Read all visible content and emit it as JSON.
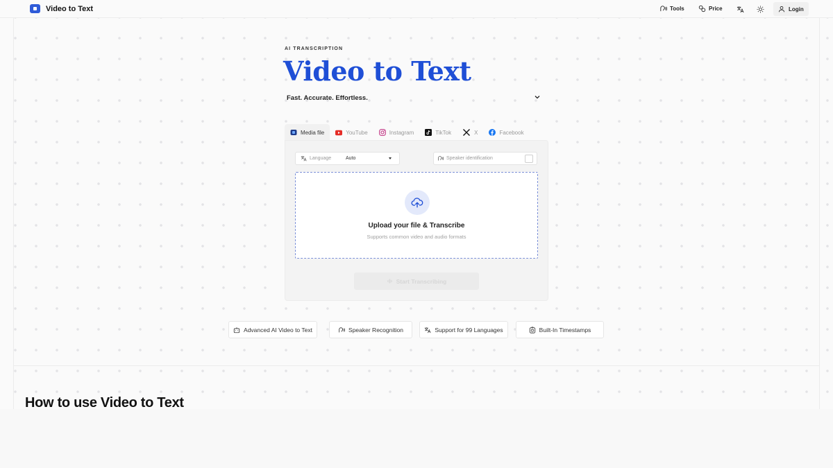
{
  "header": {
    "brand_name": "Video to Text",
    "nav": {
      "tools": "Tools",
      "price": "Price",
      "login": "Login"
    },
    "icons": {
      "translate": "translate-icon",
      "theme": "sun-icon",
      "user": "user-icon"
    }
  },
  "hero": {
    "eyebrow": "AI TRANSCRIPTION",
    "title": "Video to Text",
    "tagline": "Fast. Accurate. Effortless."
  },
  "tabs": [
    {
      "label": "Media file",
      "icon": "media-file-icon"
    },
    {
      "label": "YouTube",
      "icon": "youtube-icon"
    },
    {
      "label": "Instagram",
      "icon": "instagram-icon"
    },
    {
      "label": "TikTok",
      "icon": "tiktok-icon"
    },
    {
      "label": "X",
      "icon": "x-icon"
    },
    {
      "label": "Facebook",
      "icon": "facebook-icon"
    }
  ],
  "options": {
    "language_label": "Language",
    "language_value": "Auto",
    "speaker_label": "Speaker identification"
  },
  "upload": {
    "title": "Upload your file & Transcribe",
    "subtitle": "Supports common video and audio formats"
  },
  "start_button": "Start Transcribing",
  "features": [
    {
      "label": "Advanced AI Video to Text",
      "icon": "bot-icon"
    },
    {
      "label": "Speaker Recognition",
      "icon": "speaker-icon"
    },
    {
      "label": "Support for 99 Languages",
      "icon": "translate-icon"
    },
    {
      "label": "Built-In Timestamps",
      "icon": "timer-icon"
    }
  ],
  "section": {
    "title": "How to use Video to Text"
  },
  "colors": {
    "accent": "#1f4fd6",
    "dropzone_border": "#7a8fd8",
    "youtube": "#e52d27",
    "facebook": "#1877f2"
  }
}
